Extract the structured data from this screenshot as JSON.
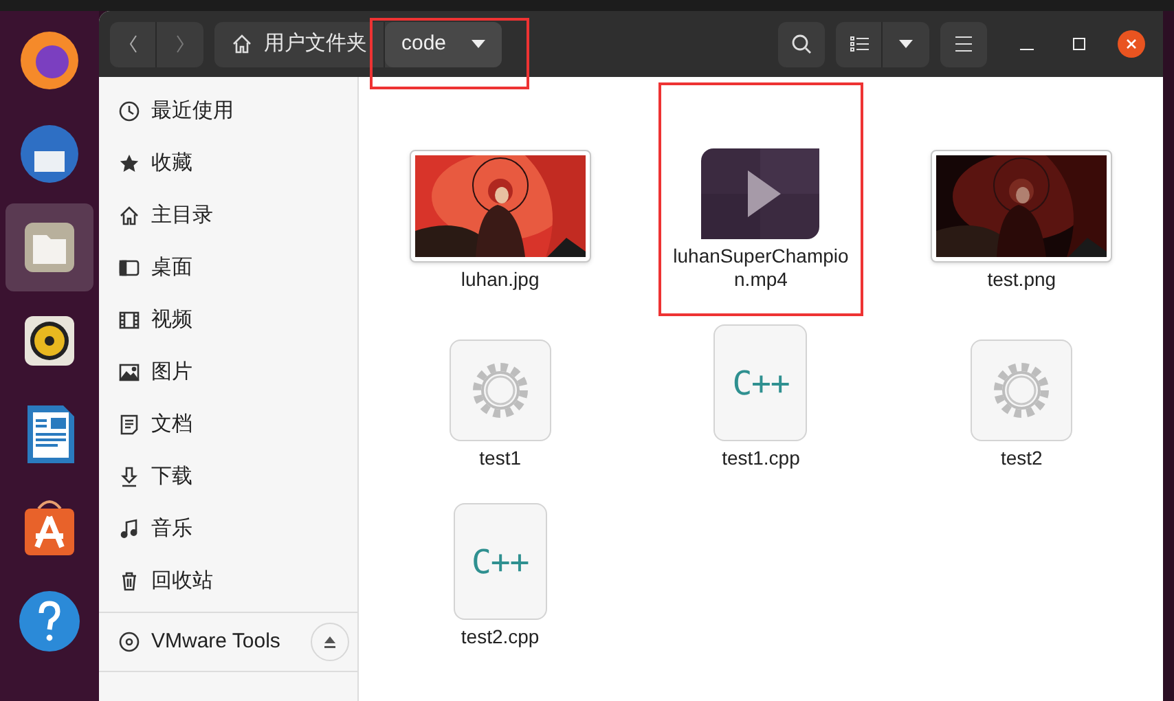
{
  "path_bar": {
    "segments": [
      {
        "label": "用户文件夹",
        "kind": "home",
        "selected": false,
        "highlighted": false
      },
      {
        "label": "code",
        "kind": "folder",
        "selected": true,
        "highlighted": true
      }
    ]
  },
  "sidebar": {
    "items": [
      {
        "label": "最近使用",
        "kind": "recent"
      },
      {
        "label": "收藏",
        "kind": "starred"
      },
      {
        "label": "主目录",
        "kind": "home"
      },
      {
        "label": "桌面",
        "kind": "desktop"
      },
      {
        "label": "视频",
        "kind": "videos"
      },
      {
        "label": "图片",
        "kind": "pictures"
      },
      {
        "label": "文档",
        "kind": "documents"
      },
      {
        "label": "下载",
        "kind": "downloads"
      },
      {
        "label": "音乐",
        "kind": "music"
      },
      {
        "label": "回收站",
        "kind": "trash"
      }
    ],
    "devices": [
      {
        "label": "VMware Tools",
        "kind": "disc"
      }
    ]
  },
  "files": [
    {
      "name": "luhan.jpg",
      "kind": "picture",
      "dark": false,
      "highlighted": false
    },
    {
      "name": "luhanSuperChampion.mp4",
      "kind": "video",
      "highlighted": true
    },
    {
      "name": "test.png",
      "kind": "picture",
      "dark": true,
      "highlighted": false
    },
    {
      "name": "test1",
      "kind": "executable",
      "highlighted": false
    },
    {
      "name": "test1.cpp",
      "kind": "cpp",
      "icon_text": "C++",
      "highlighted": false
    },
    {
      "name": "test2",
      "kind": "executable",
      "highlighted": false
    },
    {
      "name": "test2.cpp",
      "kind": "cpp",
      "icon_text": "C++",
      "highlighted": false
    }
  ]
}
